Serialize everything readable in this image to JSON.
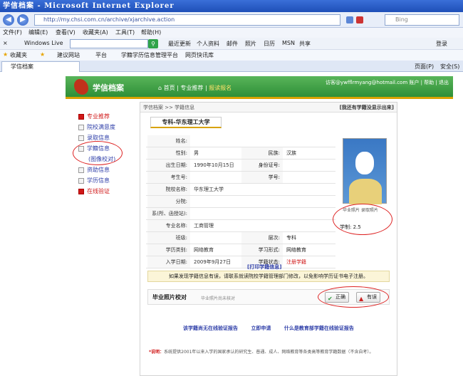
{
  "browser": {
    "title": "学信档案 - Microsoft Internet Explorer",
    "url": "http://my.chsi.com.cn/archive/xjarchive.action",
    "search_engine": "Bing",
    "menu": [
      "文件(F)",
      "编辑(E)",
      "查看(V)",
      "收藏夹(A)",
      "工具(T)",
      "帮助(H)"
    ],
    "live_toolbar": {
      "label": "Windows Live",
      "items": [
        "最近更新",
        "个人资料",
        "邮件",
        "照片",
        "日历",
        "MSN",
        "共享"
      ],
      "signin": "登录"
    },
    "favorites": {
      "label": "收藏夹",
      "items": [
        "建议网站",
        "平台",
        "学籍学历信息管理平台",
        "网页快讯库"
      ]
    },
    "tab_title": "学信档案",
    "tools": [
      "页面(P)",
      "安全(S)"
    ]
  },
  "site": {
    "logo_text": "学信档案",
    "nav": {
      "home": "首页",
      "sep1": "|",
      "recommend": "专业推荐",
      "sep2": "|",
      "apply": "报读报名"
    },
    "user": "访客@ywfflrmyang@hotmail.com 账户 | 帮助 | 退出"
  },
  "sidebar": {
    "items": [
      {
        "label": "专业推荐",
        "style": "red"
      },
      {
        "label": "院校满意度",
        "style": "normal"
      },
      {
        "label": "录取信息",
        "style": "normal"
      },
      {
        "label": "学籍信息",
        "style": "normal"
      },
      {
        "label": "(图像校对)",
        "style": "sub"
      },
      {
        "label": "资助信息",
        "style": "normal"
      },
      {
        "label": "学历信息",
        "style": "normal"
      },
      {
        "label": "在线验证",
        "style": "red"
      }
    ]
  },
  "main": {
    "breadcrumb": "学信档案 >> 学籍信息",
    "top_right": "[我还有学籍没显示出来]",
    "tab": "专科-华东理工大学",
    "fields": [
      {
        "label": "姓名:",
        "value": ""
      },
      {
        "label": "性别:",
        "value": "男",
        "label2": "民族:",
        "value2": "汉族"
      },
      {
        "label": "出生日期:",
        "value": "1990年10月15日",
        "label2": "身份证号:",
        "value2": ""
      },
      {
        "label": "考生号:",
        "value": "",
        "label2": "学号:",
        "value2": ""
      },
      {
        "label": "院校名称:",
        "value": "华东理工大学"
      },
      {
        "label": "分院:",
        "value": ""
      },
      {
        "label": "系(所、函授站):",
        "value": ""
      },
      {
        "label": "专业名称:",
        "value": "工商管理"
      },
      {
        "label": "班级:",
        "value": "",
        "label2": "层次:",
        "value2": "专科"
      },
      {
        "label": "学历类别:",
        "value": "网络教育",
        "label2": "学习形式:",
        "value2": "网络教育"
      },
      {
        "label": "入学日期:",
        "value": "2009年9月27日",
        "label2": "学籍状态:",
        "value2": "注册学籍",
        "value2_red": true
      }
    ],
    "photo_caption": "毕业照片  录取照片",
    "xuezhi_label": "学制:",
    "xuezhi_value": "2.5",
    "print_link": "[打印学籍信息]",
    "notice": "如果发现学籍信息有误，请联系就读院校学籍管理部门修改，以免影响学历证书电子注册。",
    "verify_title": "毕业照片校对",
    "verify_hint": "毕业照片尚未核对",
    "btn_correct": "正确",
    "btn_wrong": "有误",
    "bottom_links": [
      "该学籍尚无在线验证报告",
      "立即申请",
      "什么是教育部学籍在线验证报告"
    ],
    "note_lead": "*说明：",
    "note_text": "系统提供2001年以来入学的国家承认的研究生、普通、成人、网络教育等各类高等教育学籍数据（不含自考）。"
  }
}
